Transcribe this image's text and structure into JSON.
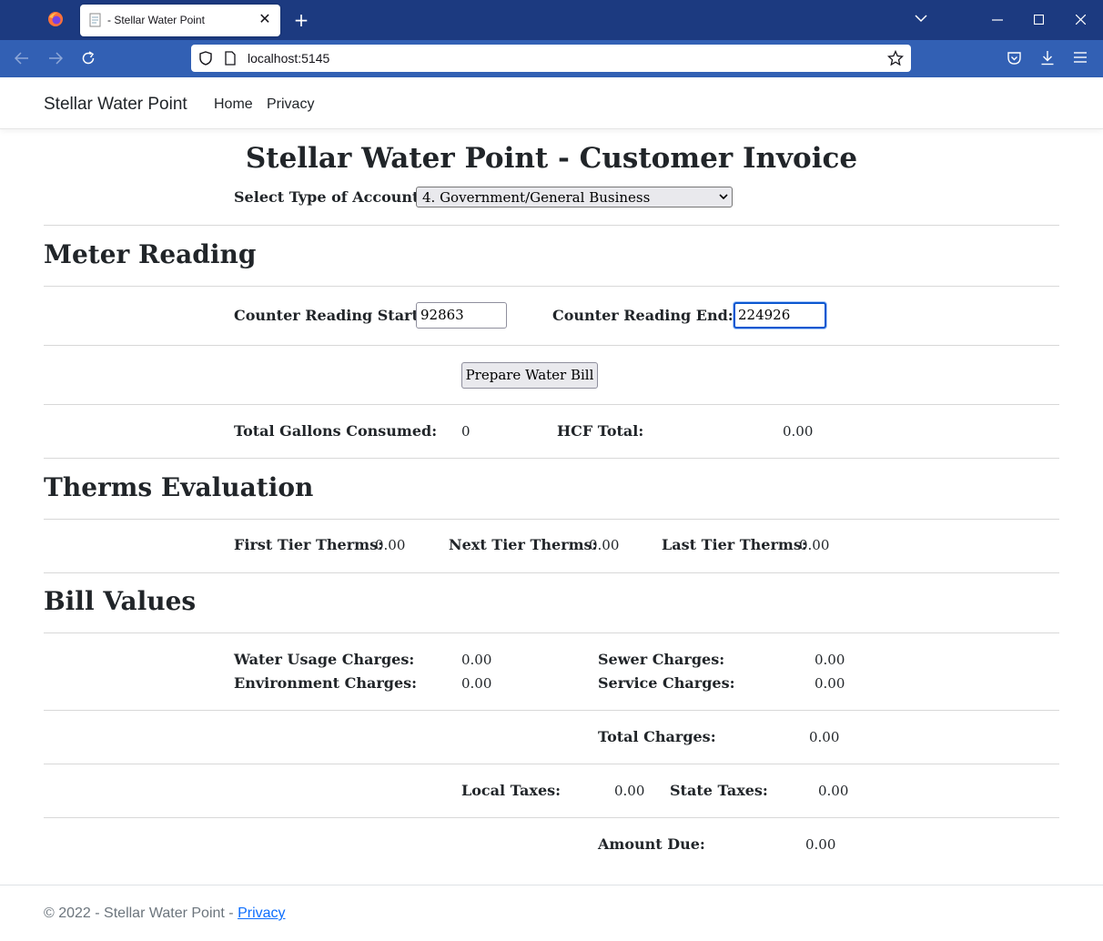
{
  "browser": {
    "tab_title": "- Stellar Water Point",
    "url": "localhost:5145"
  },
  "site": {
    "brand": "Stellar Water Point",
    "nav": {
      "home": "Home",
      "privacy": "Privacy"
    }
  },
  "invoice": {
    "title": "Stellar Water Point - Customer Invoice",
    "account_type_label": "Select Type of Account:",
    "account_type_value": "4. Government/General Business",
    "meter_section_title": "Meter Reading",
    "reading_start_label": "Counter Reading Start:",
    "reading_start_value": "92863",
    "reading_end_label": "Counter Reading End:",
    "reading_end_value": "224926",
    "prepare_button": "Prepare Water Bill",
    "gallons_label": "Total Gallons Consumed:",
    "gallons_value": "0",
    "hcf_label": "HCF Total:",
    "hcf_value": "0.00",
    "therms_section_title": "Therms Evaluation",
    "first_tier_label": "First Tier Therms:",
    "first_tier_value": "0.00",
    "next_tier_label": "Next Tier Therms:",
    "next_tier_value": "0.00",
    "last_tier_label": "Last Tier Therms:",
    "last_tier_value": "0.00",
    "bill_section_title": "Bill Values",
    "water_usage_label": "Water Usage Charges:",
    "water_usage_value": "0.00",
    "sewer_label": "Sewer Charges:",
    "sewer_value": "0.00",
    "environment_label": "Environment Charges:",
    "environment_value": "0.00",
    "service_label": "Service Charges:",
    "service_value": "0.00",
    "total_charges_label": "Total Charges:",
    "total_charges_value": "0.00",
    "local_taxes_label": "Local Taxes:",
    "local_taxes_value": "0.00",
    "state_taxes_label": "State Taxes:",
    "state_taxes_value": "0.00",
    "amount_due_label": "Amount Due:",
    "amount_due_value": "0.00"
  },
  "footer": {
    "copyright": "© 2022 - Stellar Water Point - ",
    "privacy_link": "Privacy"
  },
  "colors": {
    "tabbar": "#1c3a80",
    "navbar": "#3260b4",
    "link": "#0d6efd"
  }
}
